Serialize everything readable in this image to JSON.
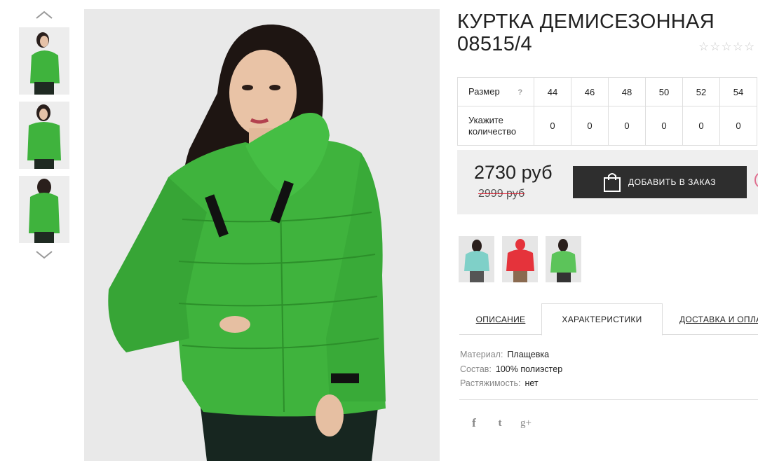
{
  "product": {
    "title": "КУРТКА ДЕМИСЕЗОННАЯ 08515/4",
    "rating_stars": "☆☆☆☆☆"
  },
  "size_table": {
    "size_label": "Размер",
    "help_mark": "?",
    "qty_label": "Укажите количество",
    "sizes": [
      "44",
      "46",
      "48",
      "50",
      "52",
      "54"
    ],
    "quantities": [
      "0",
      "0",
      "0",
      "0",
      "0",
      "0"
    ]
  },
  "price": {
    "current": "2730 руб",
    "old": "2999 руб",
    "add_button": "ДОБАВИТЬ В ЗАКАЗ"
  },
  "tabs": [
    {
      "label": "ОПИСАНИЕ",
      "active": false
    },
    {
      "label": "ХАРАКТЕРИСТИКИ",
      "active": true
    },
    {
      "label": "ДОСТАВКА И ОПЛАТА",
      "active": false
    }
  ],
  "specs": [
    {
      "key": "Материал:",
      "value": "Плащевка"
    },
    {
      "key": "Состав:",
      "value": "100% полиэстер"
    },
    {
      "key": "Растяжимость:",
      "value": "нет"
    }
  ],
  "social": [
    "f",
    "t",
    "g+"
  ],
  "colors": {
    "jacket_green": "#3fb33d",
    "jacket_mint": "#7fd0c8",
    "jacket_red": "#e5333b",
    "button_dark": "#2e2e2e",
    "price_box": "#efefef"
  },
  "icons": [
    "chevron-up-icon",
    "chevron-down-icon",
    "shopping-bag-icon",
    "heart-icon",
    "facebook-icon",
    "twitter-icon",
    "google-plus-icon",
    "star-icon"
  ]
}
